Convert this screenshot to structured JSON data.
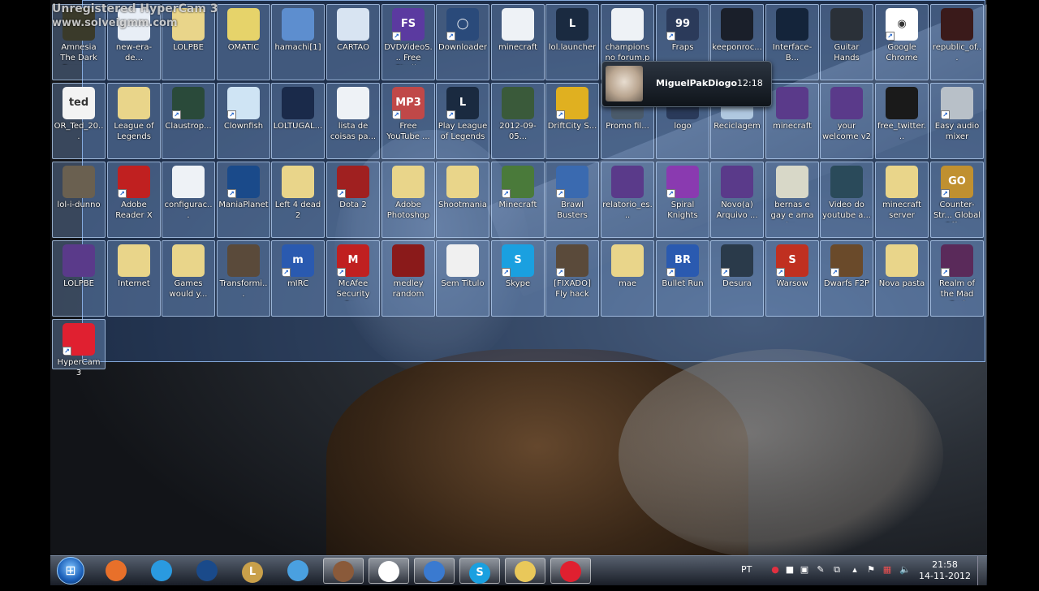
{
  "watermark": {
    "line1": "Unregistered HyperCam 3",
    "line2": "www.solveigmm.com"
  },
  "desktop_icons": [
    {
      "label": "Amnesia The Dark Desce...",
      "icon": "amnesia-game-icon",
      "color": "#3a3a2a",
      "glyph": "",
      "shortcut": false
    },
    {
      "label": "new-era-de...",
      "icon": "document-icon",
      "color": "#e8eef6",
      "glyph": "",
      "shortcut": false
    },
    {
      "label": "LOLPBE",
      "icon": "folder-icon",
      "color": "#e9d58a",
      "glyph": "",
      "shortcut": false
    },
    {
      "label": "OMATIC",
      "icon": "cheese-icon",
      "color": "#e6d36a",
      "glyph": "",
      "shortcut": false
    },
    {
      "label": "hamachi[1]",
      "icon": "installer-icon",
      "color": "#5d8ecf",
      "glyph": "",
      "shortcut": false
    },
    {
      "label": "CARTAO",
      "icon": "spreadsheet-icon",
      "color": "#d8e4f2",
      "glyph": "",
      "shortcut": false
    },
    {
      "label": "DVDVideoS... Free Studio",
      "icon": "dvdvideosoft-icon",
      "color": "#5b3aa0",
      "glyph": "FS",
      "shortcut": true
    },
    {
      "label": "Downloader",
      "icon": "downloader-icon",
      "color": "#2a4a7a",
      "glyph": "◯",
      "shortcut": true
    },
    {
      "label": "minecraft",
      "icon": "java-file-icon",
      "color": "#eef2f6",
      "glyph": "",
      "shortcut": false
    },
    {
      "label": "lol.launcher",
      "icon": "league-of-legends-icon",
      "color": "#1a2a40",
      "glyph": "L",
      "shortcut": false
    },
    {
      "label": "champions no forum.p",
      "icon": "document-icon",
      "color": "#eef2f6",
      "glyph": "",
      "shortcut": false
    },
    {
      "label": "Fraps",
      "icon": "fraps-icon",
      "color": "#2b3a5a",
      "glyph": "99",
      "shortcut": true
    },
    {
      "label": "keeponroc...",
      "icon": "image-thumbnail-icon",
      "color": "#1a1f2a",
      "glyph": "",
      "shortcut": false
    },
    {
      "label": "Interface-B...",
      "icon": "image-thumbnail-icon",
      "color": "#14243a",
      "glyph": "",
      "shortcut": false
    },
    {
      "label": "Guitar Hands",
      "icon": "image-thumbnail-icon",
      "color": "#2a3038",
      "glyph": "",
      "shortcut": false
    },
    {
      "label": "Google Chrome",
      "icon": "chrome-icon",
      "color": "#ffffff",
      "glyph": "◉",
      "shortcut": true
    },
    {
      "label": "republic_of...",
      "icon": "image-thumbnail-icon",
      "color": "#3a1a1a",
      "glyph": "",
      "shortcut": false
    },
    {
      "label": "OR_Ted_20...",
      "icon": "ted-image-icon",
      "color": "#f3f3f3",
      "glyph": "ted",
      "shortcut": false
    },
    {
      "label": "League of Legends",
      "icon": "folder-icon",
      "color": "#e9d58a",
      "glyph": "",
      "shortcut": false
    },
    {
      "label": "Claustrop...",
      "icon": "game-thumbnail-icon",
      "color": "#2a4a3a",
      "glyph": "",
      "shortcut": true
    },
    {
      "label": "Clownfish",
      "icon": "app-icon",
      "color": "#cfe4f4",
      "glyph": "",
      "shortcut": true
    },
    {
      "label": "LOLTUGAL...",
      "icon": "video-file-icon",
      "color": "#1a2a4a",
      "glyph": "",
      "shortcut": false
    },
    {
      "label": "lista de coisas pa...",
      "icon": "text-file-icon",
      "color": "#eef2f6",
      "glyph": "",
      "shortcut": false
    },
    {
      "label": "Free YouTube ...",
      "icon": "mp3-converter-icon",
      "color": "#c04848",
      "glyph": "MP3",
      "shortcut": true
    },
    {
      "label": "Play League of Legends",
      "icon": "league-of-legends-icon",
      "color": "#1a2a40",
      "glyph": "L",
      "shortcut": true
    },
    {
      "label": "2012-09-05...",
      "icon": "image-thumbnail-icon",
      "color": "#3a5a3a",
      "glyph": "",
      "shortcut": false
    },
    {
      "label": "DriftCity S...",
      "icon": "driftcity-icon",
      "color": "#e0b020",
      "glyph": "",
      "shortcut": true
    },
    {
      "label": "Promo fil...",
      "icon": "image-thumbnail-icon",
      "color": "#4a5a6a",
      "glyph": "",
      "shortcut": false
    },
    {
      "label": "logo",
      "icon": "image-thumbnail-icon",
      "color": "#2a3a5a",
      "glyph": "",
      "shortcut": false
    },
    {
      "label": "Reciclagem",
      "icon": "recycle-bin-icon",
      "color": "#b0c8e0",
      "glyph": "",
      "shortcut": false
    },
    {
      "label": "minecraft",
      "icon": "winrar-icon",
      "color": "#5a3a8a",
      "glyph": "",
      "shortcut": false
    },
    {
      "label": "your welcome v2",
      "icon": "winrar-icon",
      "color": "#5a3a8a",
      "glyph": "",
      "shortcut": false
    },
    {
      "label": "free_twitter...",
      "icon": "image-thumbnail-icon",
      "color": "#1a1a1a",
      "glyph": "",
      "shortcut": false
    },
    {
      "label": "Easy audio mixer",
      "icon": "microphone-icon",
      "color": "#b8c0c8",
      "glyph": "",
      "shortcut": true
    },
    {
      "label": "lol-i-dunno",
      "icon": "image-thumbnail-icon",
      "color": "#6a6050",
      "glyph": "",
      "shortcut": false
    },
    {
      "label": "Adobe Reader X",
      "icon": "adobe-reader-icon",
      "color": "#c02020",
      "glyph": "",
      "shortcut": true
    },
    {
      "label": "configurac...",
      "icon": "pdf-file-icon",
      "color": "#eef2f6",
      "glyph": "",
      "shortcut": false
    },
    {
      "label": "ManiaPlanet",
      "icon": "maniaplanet-icon",
      "color": "#1a4a8a",
      "glyph": "",
      "shortcut": true
    },
    {
      "label": "Left 4 dead 2",
      "icon": "folder-icon",
      "color": "#e9d58a",
      "glyph": "",
      "shortcut": false
    },
    {
      "label": "Dota 2",
      "icon": "dota2-icon",
      "color": "#a02020",
      "glyph": "",
      "shortcut": true
    },
    {
      "label": "Adobe Photoshop",
      "icon": "folder-icon",
      "color": "#e9d58a",
      "glyph": "",
      "shortcut": false
    },
    {
      "label": "Shootmania",
      "icon": "folder-icon",
      "color": "#e9d58a",
      "glyph": "",
      "shortcut": false
    },
    {
      "label": "Minecraft",
      "icon": "minecraft-icon",
      "color": "#4a7a3a",
      "glyph": "",
      "shortcut": true
    },
    {
      "label": "Brawl Busters",
      "icon": "brawl-busters-icon",
      "color": "#3a6ab0",
      "glyph": "",
      "shortcut": true
    },
    {
      "label": "relatorio_es...",
      "icon": "winrar-icon",
      "color": "#5a3a8a",
      "glyph": "",
      "shortcut": false
    },
    {
      "label": "Spiral Knights",
      "icon": "spiral-knights-icon",
      "color": "#8a3ab0",
      "glyph": "",
      "shortcut": true
    },
    {
      "label": "Novo(a) Arquivo ...",
      "icon": "winrar-icon",
      "color": "#5a3a8a",
      "glyph": "",
      "shortcut": false
    },
    {
      "label": "bernas e gay e ama piro...",
      "icon": "text-file-icon",
      "color": "#d8d8c8",
      "glyph": "",
      "shortcut": false
    },
    {
      "label": "Video do youtube a...",
      "icon": "video-file-icon",
      "color": "#2a4a5a",
      "glyph": "",
      "shortcut": false
    },
    {
      "label": "minecraft server",
      "icon": "folder-icon",
      "color": "#e9d58a",
      "glyph": "",
      "shortcut": false
    },
    {
      "label": "Counter-Str... Global Offe...",
      "icon": "csgo-icon",
      "color": "#c09030",
      "glyph": "GO",
      "shortcut": true
    },
    {
      "label": "LOLPBE",
      "icon": "winrar-icon",
      "color": "#5a3a8a",
      "glyph": "",
      "shortcut": false
    },
    {
      "label": "Internet",
      "icon": "folder-icon",
      "color": "#e9d58a",
      "glyph": "",
      "shortcut": false
    },
    {
      "label": "Games would y...",
      "icon": "folder-icon",
      "color": "#e9d58a",
      "glyph": "",
      "shortcut": false
    },
    {
      "label": "Transformi...",
      "icon": "image-thumbnail-icon",
      "color": "#5a4a3a",
      "glyph": "",
      "shortcut": false
    },
    {
      "label": "mIRC",
      "icon": "mirc-icon",
      "color": "#2a5ab0",
      "glyph": "m",
      "shortcut": true
    },
    {
      "label": "McAfee Security Sc...",
      "icon": "mcafee-icon",
      "color": "#c02020",
      "glyph": "M",
      "shortcut": true
    },
    {
      "label": "medley random",
      "icon": "video-file-icon",
      "color": "#8a1a1a",
      "glyph": "",
      "shortcut": false
    },
    {
      "label": "Sem Titulo",
      "icon": "image-thumbnail-icon",
      "color": "#f0f0f0",
      "glyph": "",
      "shortcut": false
    },
    {
      "label": "Skype",
      "icon": "skype-icon",
      "color": "#1aa0e0",
      "glyph": "S",
      "shortcut": true
    },
    {
      "label": "[FIXADO] Fly hack",
      "icon": "image-thumbnail-icon",
      "color": "#5a4a3a",
      "glyph": "",
      "shortcut": true
    },
    {
      "label": "mae",
      "icon": "folder-icon",
      "color": "#e9d58a",
      "glyph": "",
      "shortcut": false
    },
    {
      "label": "Bullet Run",
      "icon": "bullet-run-icon",
      "color": "#2a5ab0",
      "glyph": "BR",
      "shortcut": true
    },
    {
      "label": "Desura",
      "icon": "desura-icon",
      "color": "#2a3a4a",
      "glyph": "",
      "shortcut": true
    },
    {
      "label": "Warsow",
      "icon": "warsow-icon",
      "color": "#c03020",
      "glyph": "S",
      "shortcut": true
    },
    {
      "label": "Dwarfs F2P",
      "icon": "dwarfs-icon",
      "color": "#6a4a2a",
      "glyph": "",
      "shortcut": true
    },
    {
      "label": "Nova pasta",
      "icon": "folder-icon",
      "color": "#e9d58a",
      "glyph": "",
      "shortcut": false
    },
    {
      "label": "Realm of the Mad God",
      "icon": "realm-mad-god-icon",
      "color": "#5a2a5a",
      "glyph": "",
      "shortcut": true
    },
    {
      "label": "HyperCam 3",
      "icon": "hypercam-icon",
      "color": "#e02030",
      "glyph": "",
      "shortcut": true
    }
  ],
  "notification": {
    "name": "MiguelPakDiogo",
    "time": "12:18",
    "avatar": "cat-avatar"
  },
  "taskbar": {
    "start": "windows-start-orb",
    "items": [
      {
        "icon": "firefox-icon",
        "color": "#e8702a",
        "glyph": "",
        "active": false
      },
      {
        "icon": "twitter-icon",
        "color": "#2a9ae0",
        "glyph": "",
        "active": false
      },
      {
        "icon": "maniaplanet-icon",
        "color": "#1a4a8a",
        "glyph": "",
        "active": false
      },
      {
        "icon": "league-of-legends-icon",
        "color": "#c9a04a",
        "glyph": "L",
        "active": false
      },
      {
        "icon": "msn-messenger-icon",
        "color": "#4aa0e0",
        "glyph": "",
        "active": false
      },
      {
        "icon": "pony-avatar-icon",
        "color": "#8a5a3a",
        "glyph": "",
        "active": true
      },
      {
        "icon": "chrome-icon",
        "color": "#ffffff",
        "glyph": "",
        "active": true
      },
      {
        "icon": "connection-icon",
        "color": "#3a7ad0",
        "glyph": "",
        "active": true
      },
      {
        "icon": "skype-icon",
        "color": "#1aa0e0",
        "glyph": "S",
        "active": true
      },
      {
        "icon": "explorer-folder-icon",
        "color": "#e9c85a",
        "glyph": "",
        "active": true
      },
      {
        "icon": "hypercam-icon",
        "color": "#e02030",
        "glyph": "",
        "active": true
      }
    ],
    "language": "PT",
    "time": "21:58",
    "date": "14-11-2012"
  }
}
